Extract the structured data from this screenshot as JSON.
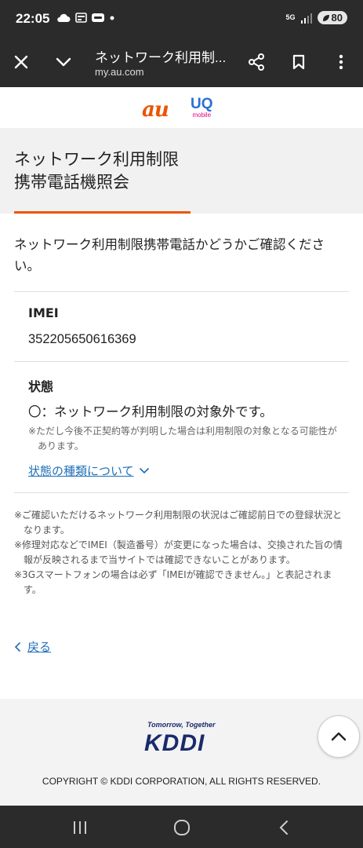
{
  "status_bar": {
    "time": "22:05",
    "battery": "80",
    "network": "5G",
    "icons_left": [
      "cloud-icon",
      "news-icon",
      "meet-icon",
      "dot-icon"
    ],
    "icons_right": [
      "5g-icon",
      "signal-icon",
      "battery-icon"
    ]
  },
  "toolbar": {
    "title": "ネットワーク利用制...",
    "url": "my.au.com",
    "buttons": [
      "close-icon",
      "chevron-down-icon",
      "share-icon",
      "bookmark-icon",
      "more-vert-icon"
    ]
  },
  "logos": {
    "au": "au",
    "uq": "UQ",
    "uq_sub": "mobile"
  },
  "page": {
    "title_line1": "ネットワーク利用制限",
    "title_line2": "携帯電話機照会",
    "intro": "ネットワーク利用制限携帯電話かどうかご確認ください。",
    "imei_label": "IMEI",
    "imei_value": "352205650616369",
    "status_label": "状態",
    "status_value": "〇：ネットワーク利用制限の対象外です。",
    "status_note": "※ただし今後不正契約等が判明した場合は利用制限の対象となる可能性があります。",
    "status_types_link": "状態の種類について",
    "footnotes": [
      "※ご確認いただけるネットワーク利用制限の状況はご確認前日での登録状況となります。",
      "※修理対応などでIMEI（製造番号）が変更になった場合は、交換された旨の情報が反映されるまで当サイトでは確認できないことがあります。",
      "※3Gスマートフォンの場合は必ず「IMEIが確認できません。」と表記されます。"
    ],
    "back_label": "戻る"
  },
  "footer": {
    "tagline": "Tomorrow, Together",
    "brand": "KDDI",
    "copyright": "COPYRIGHT © KDDI CORPORATION, ALL RIGHTS RESERVED."
  },
  "colors": {
    "accent": "#eb5505",
    "link": "#1f6fb8",
    "dark_bar": "#2b2b2b",
    "kddi_navy": "#1a2a6c"
  }
}
